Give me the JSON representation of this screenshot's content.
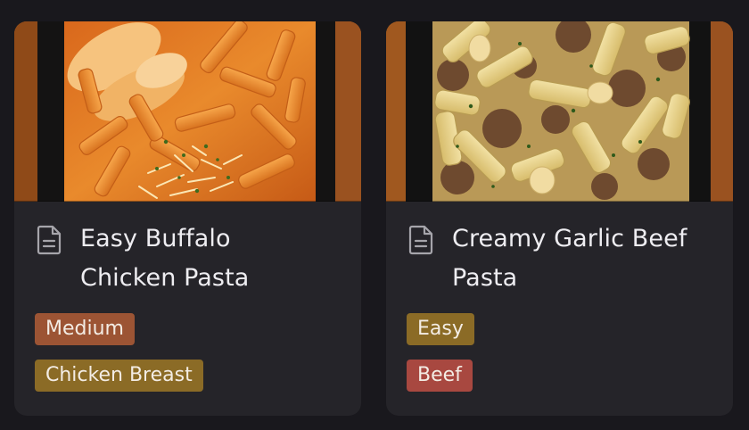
{
  "cards": [
    {
      "title": "Easy Buffalo Chicken Pasta",
      "title_line1": "Easy Buffalo",
      "title_line2": "Chicken Pasta",
      "image": "buffalo-chicken-pasta-photo",
      "icon": "document-icon",
      "tags": [
        {
          "label": "Medium",
          "color": "#9c5434"
        },
        {
          "label": "Chicken Breast",
          "color": "#8b6b26"
        }
      ]
    },
    {
      "title": "Creamy Garlic Beef Pasta",
      "title_line1": "Creamy Garlic Beef",
      "title_line2": "Pasta",
      "image": "garlic-beef-pasta-photo",
      "icon": "document-icon",
      "tags": [
        {
          "label": "Easy",
          "color": "#8b6b26"
        },
        {
          "label": "Beef",
          "color": "#a84840"
        }
      ]
    }
  ]
}
